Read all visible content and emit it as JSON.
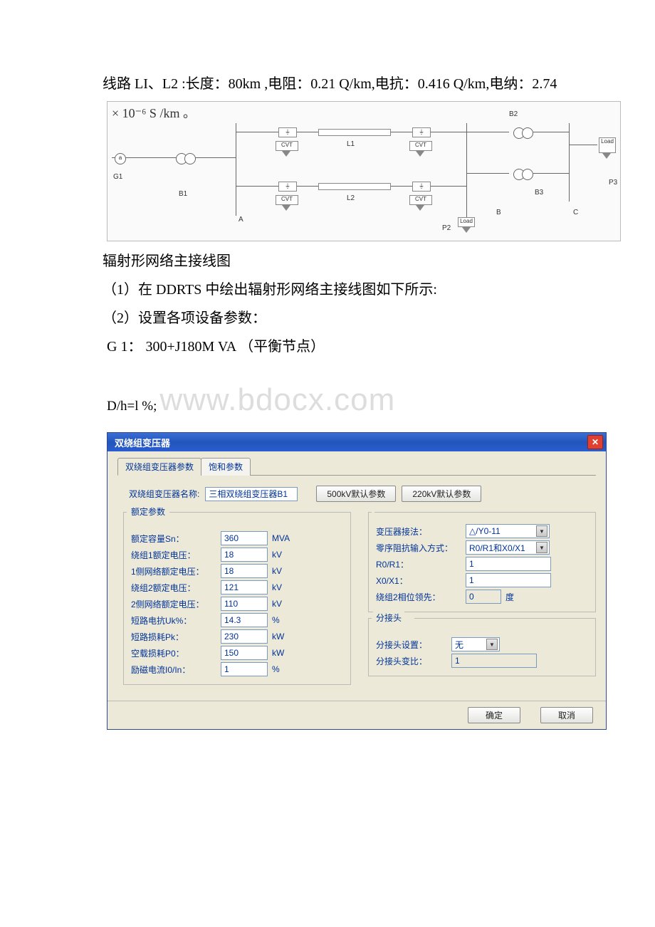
{
  "text": {
    "line1": "线路 LI、L2 :长度：80km ,电阻：0.21 Q/km,电抗：0.416 Q/km,电纳：2.74",
    "fig_expr": "× 10⁻⁶ S /km 。",
    "caption": "辐射形网络主接线图",
    "step1": "（1）在 DDRTS 中绘出辐射形网络主接线图如下所示:",
    "step2": "（2）设置各项设备参数：",
    "g1": "G 1： 300+J180M VA （平衡节点）",
    "dh": "D/h=l %;",
    "watermark": "www.bdocx.com"
  },
  "figure": {
    "G": "a",
    "G1": "G1",
    "B1": "B1",
    "B2": "B2",
    "B3": "B3",
    "L1": "L1",
    "L2": "L2",
    "A": "A",
    "B": "B",
    "C": "C",
    "P2": "P2",
    "P3": "P3",
    "Load": "Load",
    "CVT": "CVT"
  },
  "dialog": {
    "title": "双绕组变压器",
    "tabs": {
      "t1": "双绕组变压器参数",
      "t2": "饱和参数"
    },
    "name_row": {
      "label": "双绕组变压器名称:",
      "value": "三相双绕组变压器B1",
      "btn500": "500kV默认参数",
      "btn220": "220kV默认参数"
    },
    "grp_rated": {
      "legend": "额定参数",
      "rows": [
        {
          "label": "额定容量Sn：",
          "value": "360",
          "unit": "MVA"
        },
        {
          "label": "绕组1额定电压：",
          "value": "18",
          "unit": "kV"
        },
        {
          "label": "1侧网络额定电压：",
          "value": "18",
          "unit": "kV"
        },
        {
          "label": "绕组2额定电压：",
          "value": "121",
          "unit": "kV"
        },
        {
          "label": "2侧网络额定电压：",
          "value": "110",
          "unit": "kV"
        },
        {
          "label": "短路电抗Uk%：",
          "value": "14.3",
          "unit": "%"
        },
        {
          "label": "短路损耗Pk：",
          "value": "230",
          "unit": "kW"
        },
        {
          "label": "空载损耗P0：",
          "value": "150",
          "unit": "kW"
        },
        {
          "label": "励磁电流I0/In：",
          "value": "1",
          "unit": "%"
        }
      ]
    },
    "grp_right_top": {
      "rows": [
        {
          "label": "变压器接法：",
          "value": "△/Y0-11",
          "type": "combo"
        },
        {
          "label": "零序阻抗输入方式：",
          "value": "R0/R1和X0/X1",
          "type": "combo"
        },
        {
          "label": "R0/R1：",
          "value": "1",
          "type": "text"
        },
        {
          "label": "X0/X1：",
          "value": "1",
          "type": "text"
        },
        {
          "label": "绕组2相位领先：",
          "value": "0",
          "unit": "度",
          "type": "readonly"
        }
      ]
    },
    "grp_tap": {
      "legend": "分接头",
      "rows": [
        {
          "label": "分接头设置：",
          "value": "无",
          "type": "combo_small"
        },
        {
          "label": "分接头变比：",
          "value": "1",
          "type": "readonly"
        }
      ]
    },
    "buttons": {
      "ok": "确定",
      "cancel": "取消"
    }
  }
}
